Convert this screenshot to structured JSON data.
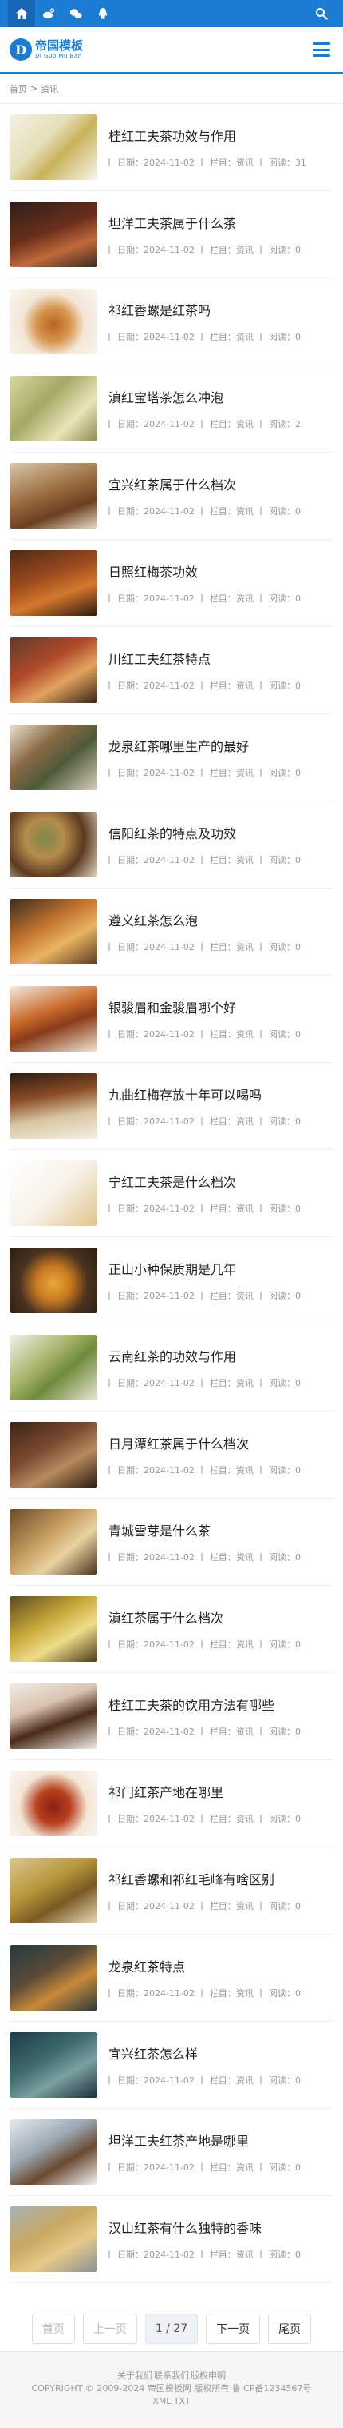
{
  "topbar": {
    "icons": [
      "home-icon",
      "weibo-icon",
      "wechat-icon",
      "qq-icon"
    ],
    "search_icon": "search-icon"
  },
  "header": {
    "logo_title": "帝国模板",
    "logo_sub": "Di Guo Mu Ban",
    "logo_letter": "D",
    "menu_icon": "hamburger-menu-icon"
  },
  "breadcrumb": {
    "home": "首页",
    "sep": ">",
    "current": "资讯"
  },
  "meta_labels": {
    "date": "日期：",
    "column": "栏目：",
    "views": "阅读："
  },
  "articles": [
    {
      "title": "桂红工夫茶功效与作用",
      "date": "2024-11-02",
      "column": "资讯",
      "views": "31"
    },
    {
      "title": "坦洋工夫茶属于什么茶",
      "date": "2024-11-02",
      "column": "资讯",
      "views": "0"
    },
    {
      "title": "祁红香螺是红茶吗",
      "date": "2024-11-02",
      "column": "资讯",
      "views": "0"
    },
    {
      "title": "滇红宝塔茶怎么冲泡",
      "date": "2024-11-02",
      "column": "资讯",
      "views": "2"
    },
    {
      "title": "宜兴红茶属于什么档次",
      "date": "2024-11-02",
      "column": "资讯",
      "views": "0"
    },
    {
      "title": "日照红梅茶功效",
      "date": "2024-11-02",
      "column": "资讯",
      "views": "0"
    },
    {
      "title": "川红工夫红茶特点",
      "date": "2024-11-02",
      "column": "资讯",
      "views": "0"
    },
    {
      "title": "龙泉红茶哪里生产的最好",
      "date": "2024-11-02",
      "column": "资讯",
      "views": "0"
    },
    {
      "title": "信阳红茶的特点及功效",
      "date": "2024-11-02",
      "column": "资讯",
      "views": "0"
    },
    {
      "title": "遵义红茶怎么泡",
      "date": "2024-11-02",
      "column": "资讯",
      "views": "0"
    },
    {
      "title": "银骏眉和金骏眉哪个好",
      "date": "2024-11-02",
      "column": "资讯",
      "views": "0"
    },
    {
      "title": "九曲红梅存放十年可以喝吗",
      "date": "2024-11-02",
      "column": "资讯",
      "views": "0"
    },
    {
      "title": "宁红工夫茶是什么档次",
      "date": "2024-11-02",
      "column": "资讯",
      "views": "0"
    },
    {
      "title": "正山小种保质期是几年",
      "date": "2024-11-02",
      "column": "资讯",
      "views": "0"
    },
    {
      "title": "云南红茶的功效与作用",
      "date": "2024-11-02",
      "column": "资讯",
      "views": "0"
    },
    {
      "title": "日月潭红茶属于什么档次",
      "date": "2024-11-02",
      "column": "资讯",
      "views": "0"
    },
    {
      "title": "青城雪芽是什么茶",
      "date": "2024-11-02",
      "column": "资讯",
      "views": "0"
    },
    {
      "title": "滇红茶属于什么档次",
      "date": "2024-11-02",
      "column": "资讯",
      "views": "0"
    },
    {
      "title": "桂红工夫茶的饮用方法有哪些",
      "date": "2024-11-02",
      "column": "资讯",
      "views": "0"
    },
    {
      "title": "祁门红茶产地在哪里",
      "date": "2024-11-02",
      "column": "资讯",
      "views": "0"
    },
    {
      "title": "祁红香螺和祁红毛峰有啥区别",
      "date": "2024-11-02",
      "column": "资讯",
      "views": "0"
    },
    {
      "title": "龙泉红茶特点",
      "date": "2024-11-02",
      "column": "资讯",
      "views": "0"
    },
    {
      "title": "宜兴红茶怎么样",
      "date": "2024-11-02",
      "column": "资讯",
      "views": "0"
    },
    {
      "title": "坦洋工夫红茶产地是哪里",
      "date": "2024-11-02",
      "column": "资讯",
      "views": "0"
    },
    {
      "title": "汉山红茶有什么独特的香味",
      "date": "2024-11-02",
      "column": "资讯",
      "views": "0"
    }
  ],
  "pager": {
    "first": "首页",
    "prev": "上一页",
    "current": "1 / 27",
    "next": "下一页",
    "last": "尾页"
  },
  "footer": {
    "links": [
      "关于我们",
      "联系我们",
      "版权申明"
    ],
    "copyright": "COPYRIGHT © 2009-2024 帝国模板网 版权所有 鲁ICP备1234567号",
    "extra": "XML TXT"
  },
  "colors": {
    "accent": "#1c7bd3"
  }
}
